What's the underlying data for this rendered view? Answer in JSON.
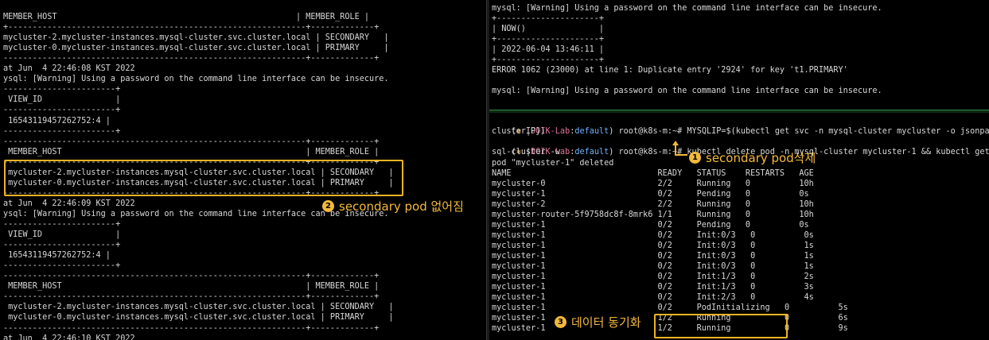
{
  "left_pane": {
    "lines": [
      "MEMBER_HOST                                                 | MEMBER_ROLE |",
      "+-------------------------------------------------------------+-------------+",
      "mycluster-2.mycluster-instances.mysql-cluster.svc.cluster.local | SECONDARY   |",
      "mycluster-0.mycluster-instances.mysql-cluster.svc.cluster.local | PRIMARY     |",
      "--------------------------------------------------------------+-------------+",
      "at Jun  4 22:46:08 KST 2022",
      "ysql: [Warning] Using a password on the command line interface can be insecure.",
      "-----------------------+",
      " VIEW_ID               |",
      "-----------------------+",
      " 16543119457262752:4 |",
      "-----------------------+",
      "--------------------------------------------------------------+-------------+",
      " MEMBER_HOST                                                  | MEMBER_ROLE |",
      "--------------------------------------------------------------+-------------+",
      " mycluster-2.mycluster-instances.mysql-cluster.svc.cluster.local | SECONDARY   |",
      " mycluster-0.mycluster-instances.mysql-cluster.svc.cluster.local | PRIMARY     |",
      "--------------------------------------------------------------+-------------+",
      "at Jun  4 22:46:09 KST 2022",
      "ysql: [Warning] Using a password on the command line interface can be insecure.",
      "-----------------------+",
      " VIEW_ID               |",
      "-----------------------+",
      " 16543119457262752:4 |",
      "-----------------------+",
      "--------------------------------------------------------------+-------------+",
      " MEMBER_HOST                                                  | MEMBER_ROLE |",
      "--------------------------------------------------------------+-------------+",
      " mycluster-2.mycluster-instances.mysql-cluster.svc.cluster.local | SECONDARY   |",
      " mycluster-0.mycluster-instances.mysql-cluster.svc.cluster.local | PRIMARY     |",
      "--------------------------------------------------------------+-------------+",
      "at Jun  4 22:46:10 KST 2022"
    ]
  },
  "right_top_pane": {
    "lines": [
      "mysql: [Warning] Using a password on the command line interface can be insecure.",
      "+---------------------+",
      "| NOW()               |",
      "+---------------------+",
      "| 2022-06-04 13:46:11 |",
      "+---------------------+",
      "ERROR 1062 (23000) at line 1: Duplicate entry '2924' for key 't1.PRIMARY'",
      "",
      "mysql: [Warning] Using a password on the command line interface can be insecure."
    ]
  },
  "right_bottom_pane": {
    "prompt": {
      "open": "(",
      "icon": "⎈",
      "sep": " |",
      "name": "DOIK-Lab",
      "colon": ":",
      "ns": "default",
      "close": ")",
      "user": " root@k8s-m:~# "
    },
    "cmd1": "MYSQLIP=$(kubectl get svc -n mysql-cluster mycluster -o jsonpath",
    "cmd1_cont": "clusterIP})",
    "cmd2": "kubectl delete pod -n mysql-cluster mycluster-1 && kubectl get p",
    "cmd2_cont": "sql-cluster -w",
    "lines": [
      "pod \"mycluster-1\" deleted",
      "NAME                              READY   STATUS    RESTARTS   AGE",
      "mycluster-0                       2/2     Running   0          10h",
      "mycluster-1                       0/2     Pending   0          0s",
      "mycluster-2                       2/2     Running   0          10h",
      "mycluster-router-5f9758dc8f-8mrk6 1/1     Running   0          10h",
      "mycluster-1                       0/2     Pending   0          0s",
      "mycluster-1                       0/2     Init:0/3   0          0s",
      "mycluster-1                       0/2     Init:0/3   0          1s",
      "mycluster-1                       0/2     Init:0/3   0          1s",
      "mycluster-1                       0/2     Init:0/3   0          1s",
      "mycluster-1                       0/2     Init:1/3   0          2s",
      "mycluster-1                       0/2     Init:1/3   0          3s",
      "mycluster-1                       0/2     Init:2/3   0          4s",
      "mycluster-1                       0/2     PodInitializing   0          5s",
      "mycluster-1                       1/2     Running           0          6s",
      "mycluster-1                       1/2     Running           0          9s"
    ]
  },
  "annotations": {
    "a1": {
      "num": "1",
      "text": "secondary pod삭제"
    },
    "a2": {
      "num": "2",
      "text": "secondary pod 없어짐"
    },
    "a3": {
      "num": "3",
      "text": "데이터 동기화"
    }
  },
  "colors": {
    "annotation": "#f4b93a",
    "prompt_name": "#e0709a",
    "prompt_ns": "#6fb3ff",
    "pane_divider": "#2f8f45"
  }
}
